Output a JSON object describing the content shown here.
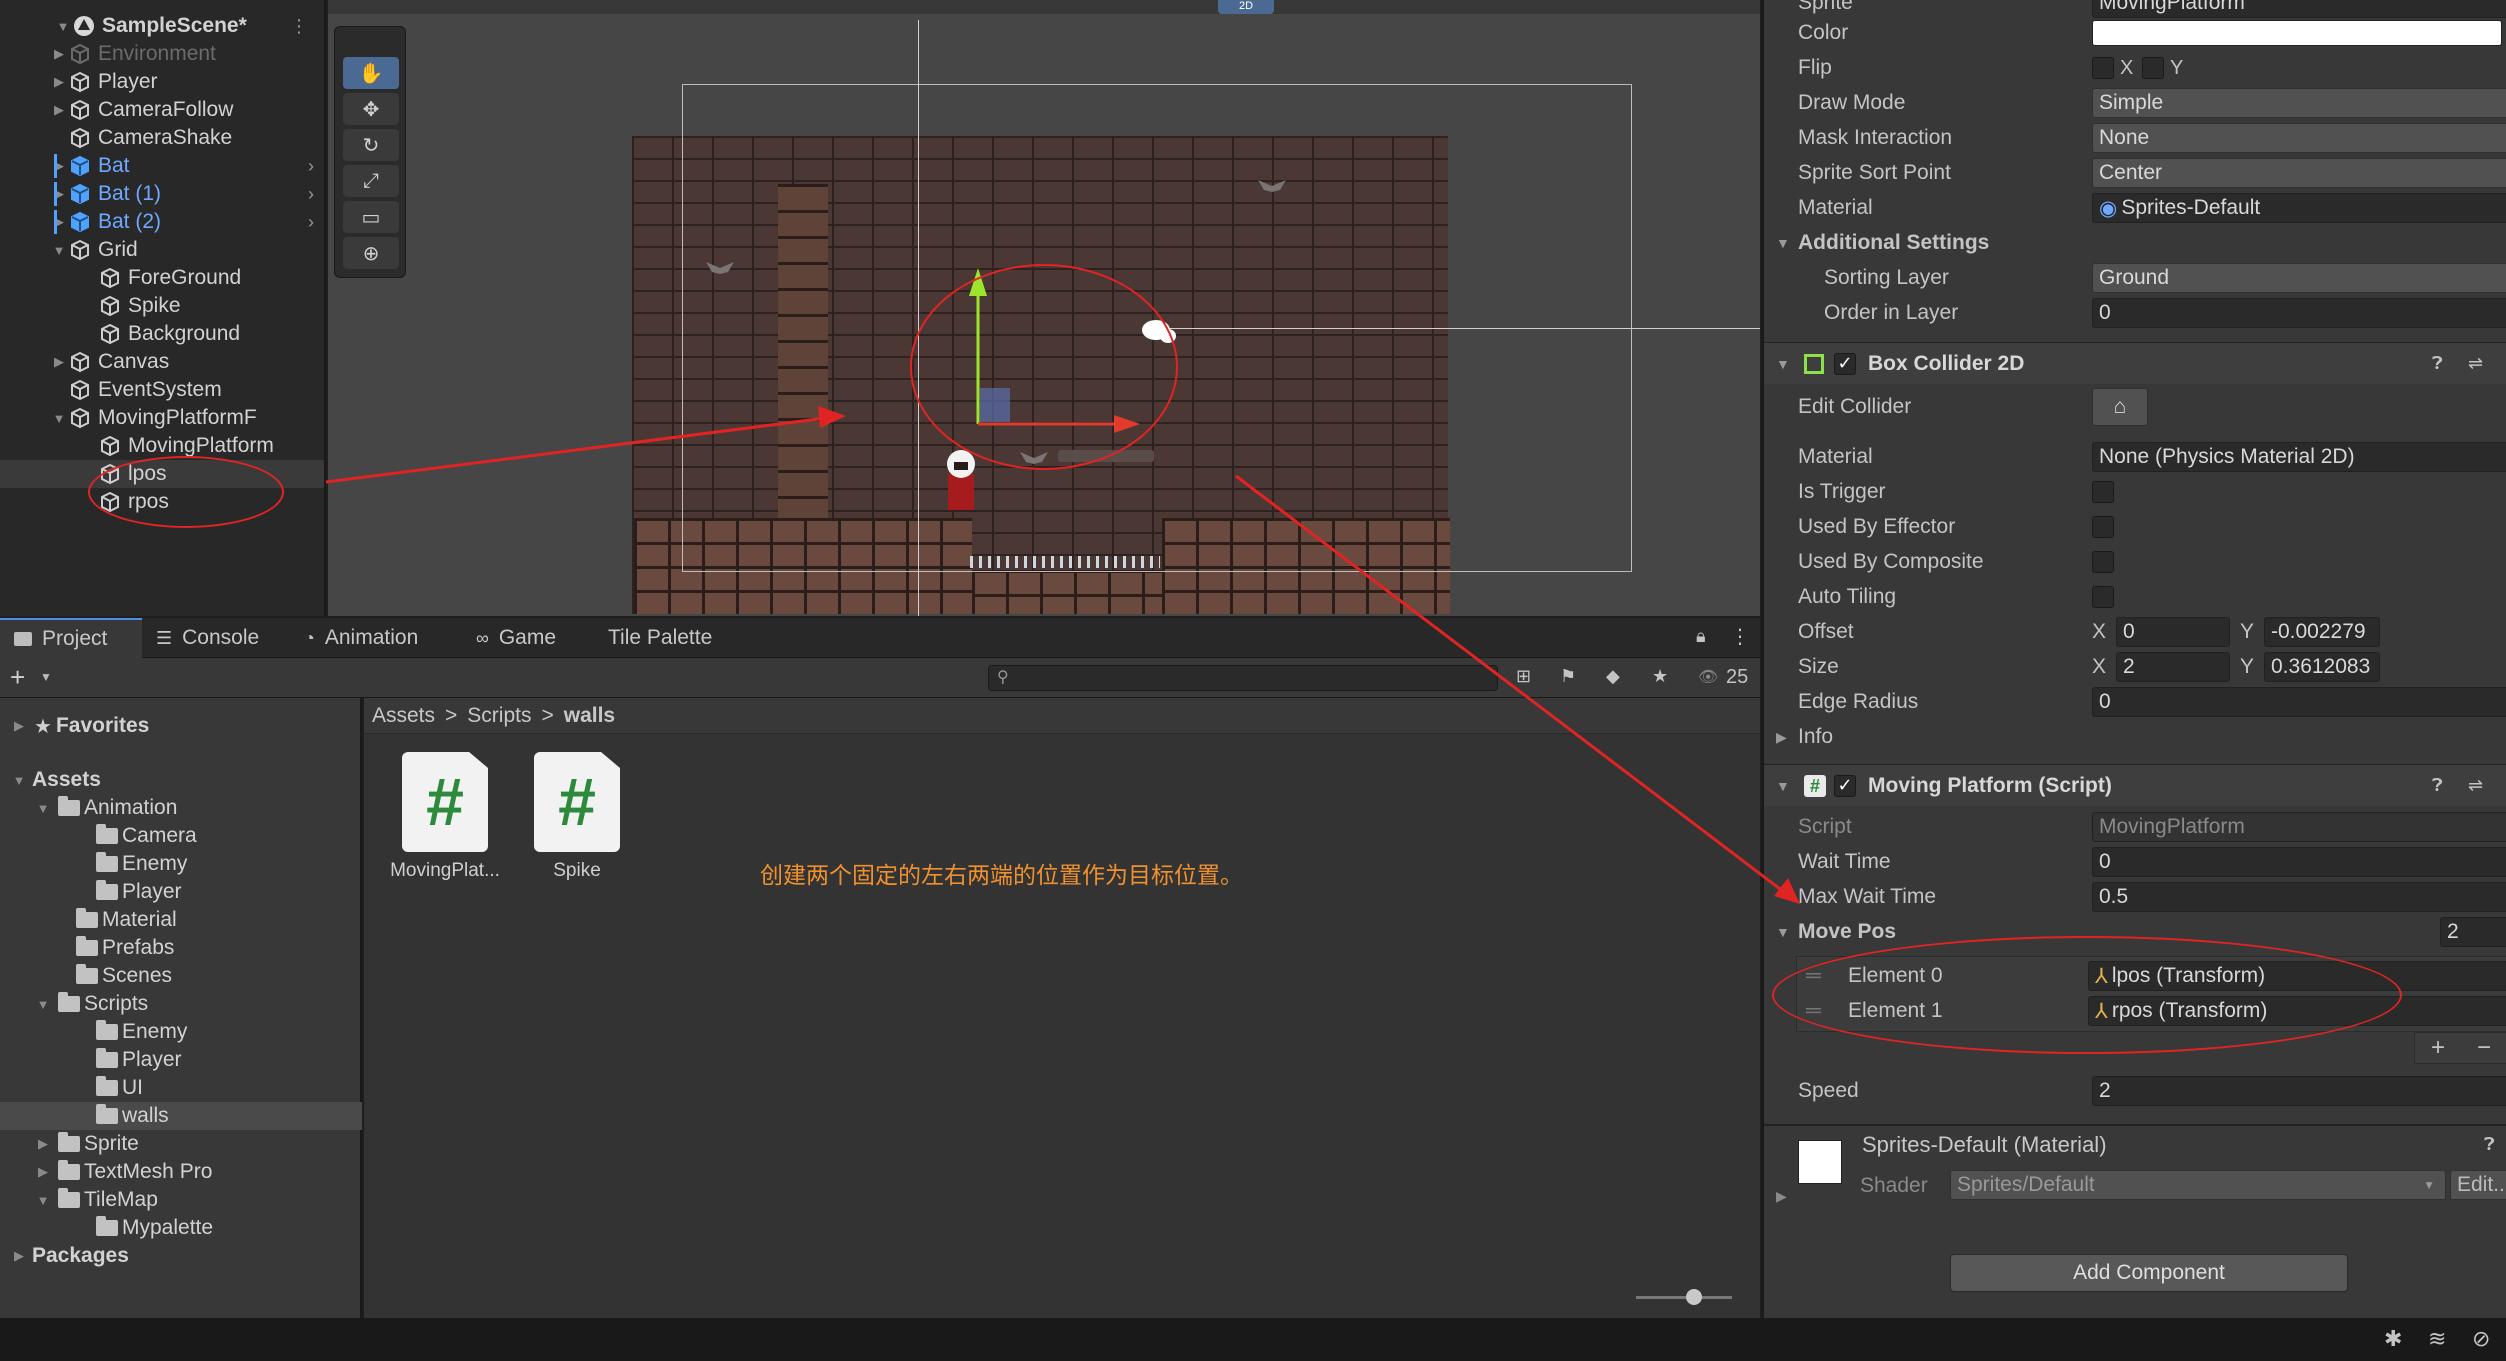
{
  "hierarchy": {
    "scene_name": "SampleScene*",
    "items": [
      {
        "label": "Environment",
        "state": "dim"
      },
      {
        "label": "Player"
      },
      {
        "label": "CameraFollow"
      },
      {
        "label": "CameraShake"
      },
      {
        "label": "Bat",
        "state": "prefab"
      },
      {
        "label": "Bat (1)",
        "state": "prefab"
      },
      {
        "label": "Bat (2)",
        "state": "prefab"
      },
      {
        "label": "Grid"
      },
      {
        "label": "ForeGround"
      },
      {
        "label": "Spike"
      },
      {
        "label": "Background"
      },
      {
        "label": "Canvas"
      },
      {
        "label": "EventSystem"
      },
      {
        "label": "MovingPlatformF"
      },
      {
        "label": "MovingPlatform"
      },
      {
        "label": "lpos"
      },
      {
        "label": "rpos"
      }
    ]
  },
  "scene_toolbar": {
    "mode_2d": "2D"
  },
  "bottom_tabs": [
    "Project",
    "Console",
    "Animation",
    "Game",
    "Tile Palette"
  ],
  "project": {
    "visible_count": "25",
    "breadcrumbs": [
      "Assets",
      ">",
      "Scripts",
      ">",
      "walls"
    ],
    "tree": [
      {
        "label": "Favorites",
        "bold": true
      },
      {
        "label": "Assets",
        "bold": true
      },
      {
        "label": "Animation"
      },
      {
        "label": "Camera"
      },
      {
        "label": "Enemy"
      },
      {
        "label": "Player"
      },
      {
        "label": "Material"
      },
      {
        "label": "Prefabs"
      },
      {
        "label": "Scenes"
      },
      {
        "label": "Scripts"
      },
      {
        "label": "Enemy"
      },
      {
        "label": "Player"
      },
      {
        "label": "UI"
      },
      {
        "label": "walls"
      },
      {
        "label": "Sprite"
      },
      {
        "label": "TextMesh Pro"
      },
      {
        "label": "TileMap"
      },
      {
        "label": "Mypalette"
      },
      {
        "label": "Packages",
        "bold": true
      }
    ],
    "files": [
      {
        "label": "MovingPlat...",
        "glyph": "#"
      },
      {
        "label": "Spike",
        "glyph": "#"
      }
    ],
    "annotation": "创建两个固定的左右两端的位置作为目标位置。"
  },
  "inspector": {
    "sprite_label": "Sprite",
    "sprite_value": "MovingPlatform",
    "color_label": "Color",
    "flip_label": "Flip",
    "flip_x": "X",
    "flip_y": "Y",
    "draw_mode_label": "Draw Mode",
    "draw_mode": "Simple",
    "mask_label": "Mask Interaction",
    "mask": "None",
    "sort_point_label": "Sprite Sort Point",
    "sort_point": "Center",
    "material_label": "Material",
    "material": "Sprites-Default",
    "additional_label": "Additional Settings",
    "sorting_layer_label": "Sorting Layer",
    "sorting_layer": "Ground",
    "order_label": "Order in Layer",
    "order": "0",
    "box_collider": {
      "title": "Box Collider 2D",
      "edit_label": "Edit Collider",
      "material_label": "Material",
      "material": "None (Physics Material 2D)",
      "trigger_label": "Is Trigger",
      "effector_label": "Used By Effector",
      "composite_label": "Used By Composite",
      "tiling_label": "Auto Tiling",
      "offset_label": "Offset",
      "offset_x_label": "X",
      "offset_x": "0",
      "offset_y_label": "Y",
      "offset_y": "-0.002279",
      "size_label": "Size",
      "size_x_label": "X",
      "size_x": "2",
      "size_y_label": "Y",
      "size_y": "0.3612083",
      "edge_label": "Edge Radius",
      "edge": "0",
      "info_label": "Info"
    },
    "moving_platform": {
      "title": "Moving Platform (Script)",
      "script_label": "Script",
      "script": "MovingPlatform",
      "wait_label": "Wait Time",
      "wait": "0",
      "max_wait_label": "Max Wait Time",
      "max_wait": "0.5",
      "move_pos_label": "Move Pos",
      "move_pos_count": "2",
      "element0_label": "Element 0",
      "element0": "lpos (Transform)",
      "element1_label": "Element 1",
      "element1": "rpos (Transform)",
      "plus": "+",
      "minus": "−",
      "speed_label": "Speed",
      "speed": "2"
    },
    "material_block": {
      "title": "Sprites-Default (Material)",
      "shader_label": "Shader",
      "shader": "Sprites/Default",
      "edit": "Edit..."
    },
    "add_component": "Add Component"
  },
  "colors": {
    "accent": "#4d8ee8",
    "annotation": "#e02424",
    "prefab": "#6ea9ff"
  }
}
